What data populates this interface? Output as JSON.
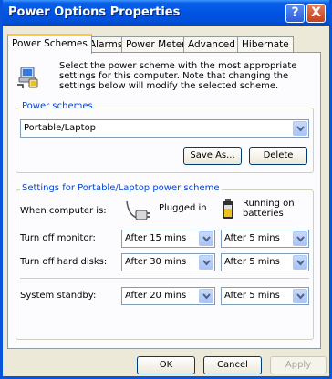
{
  "window": {
    "title": "Power Options Properties",
    "help_glyph": "?",
    "close_glyph": "X"
  },
  "tabs": [
    {
      "label": "Power Schemes",
      "active": true
    },
    {
      "label": "Alarms"
    },
    {
      "label": "Power Meter"
    },
    {
      "label": "Advanced"
    },
    {
      "label": "Hibernate"
    }
  ],
  "intro": {
    "text": "Select the power scheme with the most appropriate settings for this computer. Note that changing the settings below will modify the selected scheme.",
    "icon": "power-options-icon"
  },
  "schemes_group": {
    "label": "Power schemes",
    "selected": "Portable/Laptop",
    "save_as_label": "Save As...",
    "delete_label": "Delete"
  },
  "settings_group": {
    "label": "Settings for Portable/Laptop power scheme",
    "when_label": "When computer is:",
    "plugged_in_label": "Plugged in",
    "on_batteries_label": "Running on batteries",
    "rows": [
      {
        "label": "Turn off monitor:",
        "plugged": "After 15 mins",
        "battery": "After 5 mins"
      },
      {
        "label": "Turn off hard disks:",
        "plugged": "After 30 mins",
        "battery": "After 5 mins"
      },
      {
        "label": "System standby:",
        "plugged": "After 20 mins",
        "battery": "After 5 mins"
      }
    ]
  },
  "dialog_buttons": {
    "ok": "OK",
    "cancel": "Cancel",
    "apply": "Apply"
  },
  "colors": {
    "titlebar": "#0054e3",
    "tab_highlight": "#ffc83c",
    "group_label": "#0046d5"
  }
}
